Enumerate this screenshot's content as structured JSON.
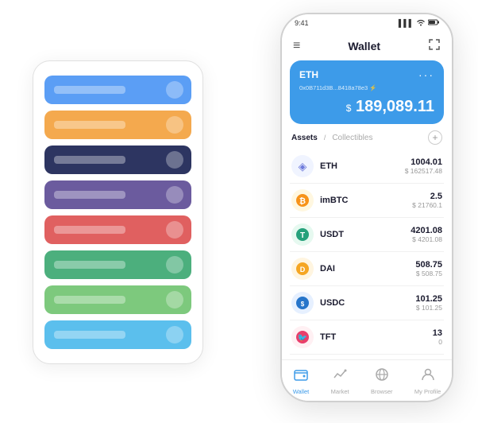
{
  "status_bar": {
    "time": "9:41",
    "signal": "▌▌▌",
    "wifi": "WiFi",
    "battery": "🔋"
  },
  "nav": {
    "menu_icon": "≡",
    "title": "Wallet",
    "expand_icon": "⛶"
  },
  "wallet_card": {
    "label": "ETH",
    "dots": "···",
    "address": "0x0B711d3B...8418a78e3 ⚡",
    "balance_sign": "$",
    "balance": "189,089.11"
  },
  "assets_section": {
    "tab_active": "Assets",
    "slash": "/",
    "tab_inactive": "Collectibles",
    "add_icon": "+"
  },
  "assets": [
    {
      "icon": "◈",
      "icon_class": "eth-icon",
      "name": "ETH",
      "amount": "1004.01",
      "usd": "$ 162517.48"
    },
    {
      "icon": "₿",
      "icon_class": "imbtc-icon",
      "name": "imBTC",
      "amount": "2.5",
      "usd": "$ 21760.1"
    },
    {
      "icon": "T",
      "icon_class": "usdt-icon",
      "name": "USDT",
      "amount": "4201.08",
      "usd": "$ 4201.08"
    },
    {
      "icon": "◎",
      "icon_class": "dai-icon",
      "name": "DAI",
      "amount": "508.75",
      "usd": "$ 508.75"
    },
    {
      "icon": "⊕",
      "icon_class": "usdc-icon",
      "name": "USDC",
      "amount": "101.25",
      "usd": "$ 101.25"
    },
    {
      "icon": "🐦",
      "icon_class": "tft-icon",
      "name": "TFT",
      "amount": "13",
      "usd": "0"
    }
  ],
  "bottom_nav": [
    {
      "icon": "⊙",
      "label": "Wallet",
      "active": true
    },
    {
      "icon": "📈",
      "label": "Market",
      "active": false
    },
    {
      "icon": "🌐",
      "label": "Browser",
      "active": false
    },
    {
      "icon": "👤",
      "label": "My Profile",
      "active": false
    }
  ],
  "card_stack": [
    {
      "color": "card-blue",
      "label": ""
    },
    {
      "color": "card-orange",
      "label": ""
    },
    {
      "color": "card-dark",
      "label": ""
    },
    {
      "color": "card-purple",
      "label": ""
    },
    {
      "color": "card-red",
      "label": ""
    },
    {
      "color": "card-green",
      "label": ""
    },
    {
      "color": "card-lightgreen",
      "label": ""
    },
    {
      "color": "card-lightblue",
      "label": ""
    }
  ]
}
